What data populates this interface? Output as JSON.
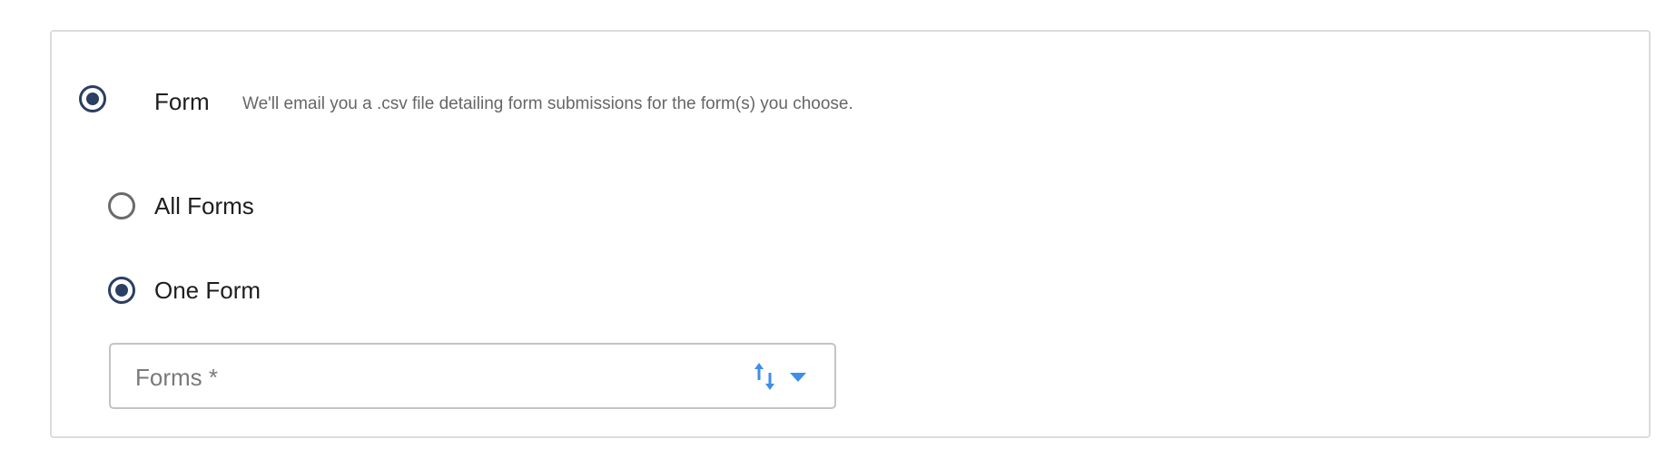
{
  "export_type": {
    "form_option": {
      "label": "Form",
      "description": "We'll email you a .csv file detailing form submissions for the form(s) you choose.",
      "selected": true
    },
    "scope_options": [
      {
        "label": "All Forms",
        "selected": false
      },
      {
        "label": "One Form",
        "selected": true
      }
    ],
    "forms_select": {
      "placeholder": "Forms *"
    }
  },
  "colors": {
    "radio_checked": "#2b3e63",
    "radio_unchecked": "#6b6b6b",
    "accent_icon": "#3d8fe8",
    "panel_border": "#dcdcdc"
  }
}
